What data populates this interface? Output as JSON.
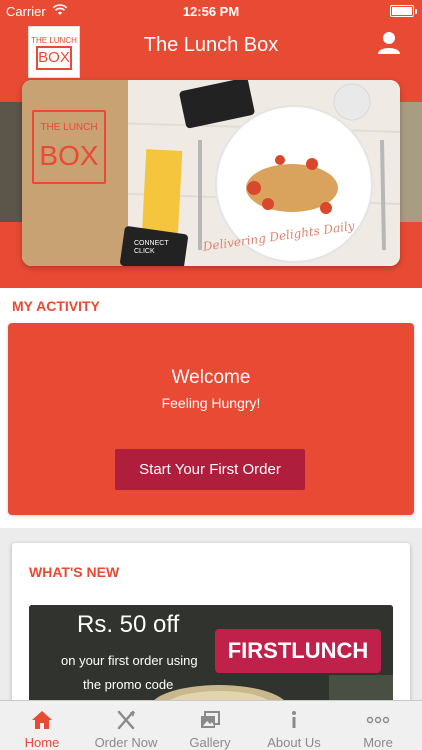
{
  "status_bar": {
    "carrier": "Carrier",
    "time": "12:56 PM"
  },
  "header": {
    "title": "The Lunch Box",
    "logo_top": "THE LUNCH",
    "logo_main": "BOX"
  },
  "banner": {
    "logo_top": "THE LUNCH",
    "logo_main": "BOX",
    "tagline": "Delivering Delights Daily",
    "card_text": "CONNECT CLICK"
  },
  "activity": {
    "section_title": "MY ACTIVITY",
    "welcome": "Welcome",
    "subtitle": "Feeling Hungry!",
    "button_label": "Start Your First Order"
  },
  "whats_new": {
    "section_title": "WHAT'S NEW",
    "promo_amount": "Rs. 50 off",
    "promo_line1": "on your first order using",
    "promo_line2": "the promo code",
    "promo_code": "FIRSTLUNCH"
  },
  "tabs": [
    {
      "label": "Home",
      "icon": "home-icon",
      "active": true
    },
    {
      "label": "Order Now",
      "icon": "fork-knife-icon",
      "active": false
    },
    {
      "label": "Gallery",
      "icon": "gallery-icon",
      "active": false
    },
    {
      "label": "About Us",
      "icon": "info-icon",
      "active": false
    },
    {
      "label": "More",
      "icon": "more-icon",
      "active": false
    }
  ],
  "colors": {
    "brand": "#e84a34",
    "button": "#b01e3e",
    "tab_inactive": "#8a8a8a"
  }
}
